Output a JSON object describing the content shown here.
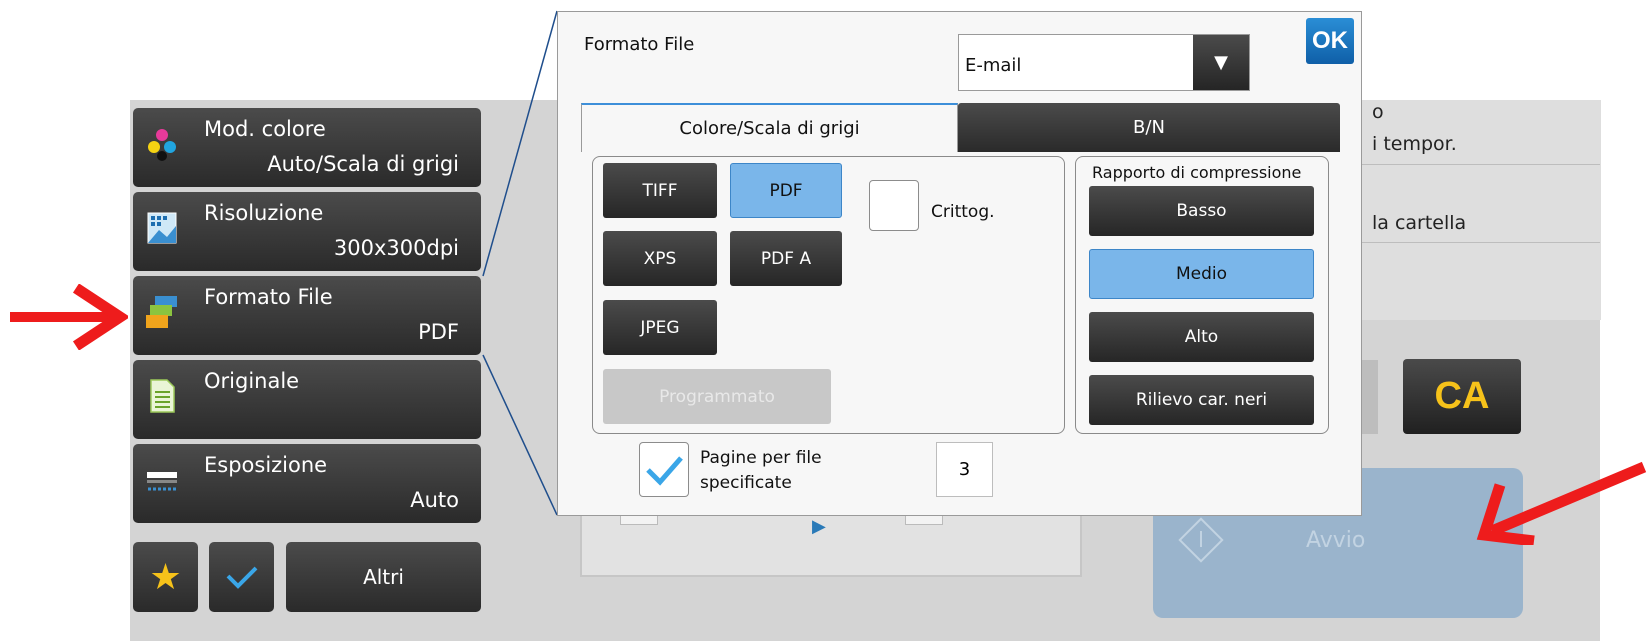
{
  "left_menu": {
    "items": [
      {
        "title": "Mod. colore",
        "value": "Auto/Scala di grigi"
      },
      {
        "title": "Risoluzione",
        "value": "300x300dpi"
      },
      {
        "title": "Formato File",
        "value": "PDF"
      },
      {
        "title": "Originale",
        "value": ""
      },
      {
        "title": "Esposizione",
        "value": "Auto"
      }
    ],
    "altri_label": "Altri"
  },
  "background": {
    "right_texts": [
      "o",
      "i tempor.",
      "la cartella"
    ],
    "ca_label": "CA",
    "start_label": "Avvio"
  },
  "dialog": {
    "title": "Formato File",
    "select_value": "E-mail",
    "ok_label": "OK",
    "tabs": [
      {
        "label": "Colore/Scala di grigi",
        "active": true
      },
      {
        "label": "B/N",
        "active": false
      }
    ],
    "formats": [
      {
        "label": "TIFF",
        "selected": false
      },
      {
        "label": "PDF",
        "selected": true
      },
      {
        "label": "XPS",
        "selected": false
      },
      {
        "label": "PDF A",
        "selected": false
      },
      {
        "label": "JPEG",
        "selected": false
      }
    ],
    "programmato_label": "Programmato",
    "crittog_label": "Crittog.",
    "compression": {
      "title": "Rapporto di compressione",
      "options": [
        {
          "label": "Basso",
          "selected": false
        },
        {
          "label": "Medio",
          "selected": true
        },
        {
          "label": "Alto",
          "selected": false
        },
        {
          "label": "Rilievo car. neri",
          "selected": false
        }
      ]
    },
    "pages_label_line1": "Pagine per file",
    "pages_label_line2": "specificate",
    "pages_checked": true,
    "pages_value": "3"
  },
  "colors": {
    "accent": "#7ab6ea",
    "arrow": "#ee1c1c",
    "ca_text": "#f6c21a",
    "dark_button": "#333333"
  }
}
